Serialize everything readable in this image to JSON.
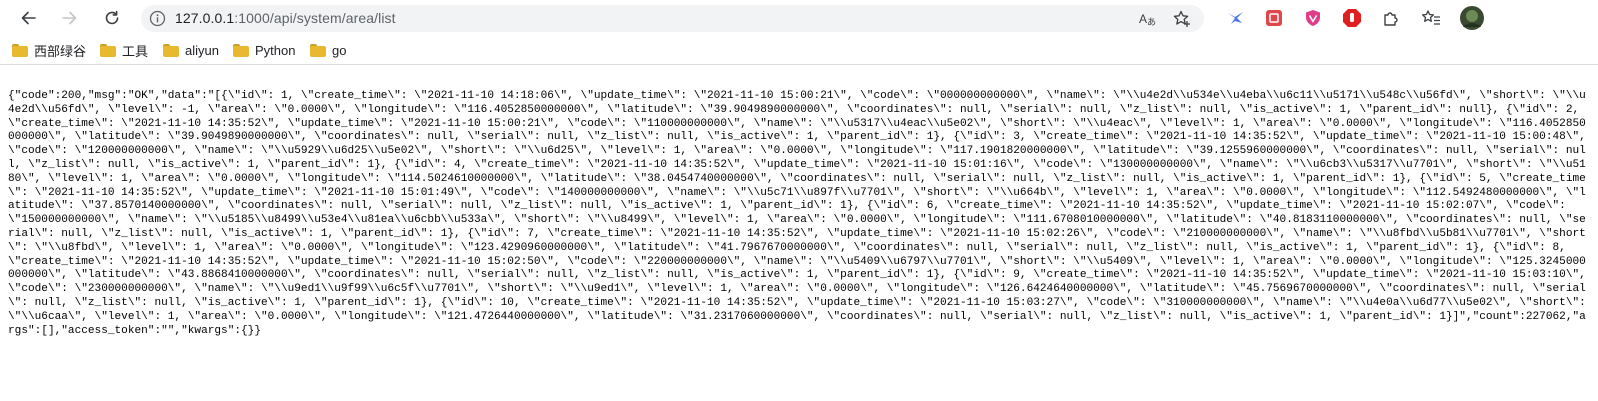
{
  "toolbar": {
    "back_icon": "arrow-left-icon",
    "forward_icon": "arrow-right-icon",
    "reload_icon": "reload-icon",
    "info_icon": "info-icon",
    "url_host": "127.0.0.1",
    "url_path": ":1000/api/system/area/list",
    "read_aloud_icon": "read-aloud-icon",
    "add_favorite_icon": "add-favorite-icon",
    "extensions": [
      "bird-extension-icon",
      "red-square-extension-icon",
      "heart-shield-extension-icon",
      "stop-hand-extension-icon",
      "puzzle-extensions-icon",
      "favorites-icon",
      "profile-avatar"
    ]
  },
  "bookmarks": [
    {
      "label": "西部绿谷",
      "icon": "folder-icon"
    },
    {
      "label": "工具",
      "icon": "folder-icon"
    },
    {
      "label": "aliyun",
      "icon": "folder-icon"
    },
    {
      "label": "Python",
      "icon": "folder-icon"
    },
    {
      "label": "go",
      "icon": "folder-icon"
    }
  ],
  "response_text": "{\"code\":200,\"msg\":\"OK\",\"data\":\"[{\\\"id\\\": 1, \\\"create_time\\\": \\\"2021-11-10 14:18:06\\\", \\\"update_time\\\": \\\"2021-11-10 15:00:21\\\", \\\"code\\\": \\\"000000000000\\\", \\\"name\\\": \\\"\\\\u4e2d\\\\u534e\\\\u4eba\\\\u6c11\\\\u5171\\\\u548c\\\\u56fd\\\", \\\"short\\\": \\\"\\\\u4e2d\\\\u56fd\\\", \\\"level\\\": -1, \\\"area\\\": \\\"0.0000\\\", \\\"longitude\\\": \\\"116.4052850000000\\\", \\\"latitude\\\": \\\"39.9049890000000\\\", \\\"coordinates\\\": null, \\\"serial\\\": null, \\\"z_list\\\": null, \\\"is_active\\\": 1, \\\"parent_id\\\": null}, {\\\"id\\\": 2, \\\"create_time\\\": \\\"2021-11-10 14:35:52\\\", \\\"update_time\\\": \\\"2021-11-10 15:00:21\\\", \\\"code\\\": \\\"110000000000\\\", \\\"name\\\": \\\"\\\\u5317\\\\u4eac\\\\u5e02\\\", \\\"short\\\": \\\"\\\\u4eac\\\", \\\"level\\\": 1, \\\"area\\\": \\\"0.0000\\\", \\\"longitude\\\": \\\"116.4052850000000\\\", \\\"latitude\\\": \\\"39.9049890000000\\\", \\\"coordinates\\\": null, \\\"serial\\\": null, \\\"z_list\\\": null, \\\"is_active\\\": 1, \\\"parent_id\\\": 1}, {\\\"id\\\": 3, \\\"create_time\\\": \\\"2021-11-10 14:35:52\\\", \\\"update_time\\\": \\\"2021-11-10 15:00:48\\\", \\\"code\\\": \\\"120000000000\\\", \\\"name\\\": \\\"\\\\u5929\\\\u6d25\\\\u5e02\\\", \\\"short\\\": \\\"\\\\u6d25\\\", \\\"level\\\": 1, \\\"area\\\": \\\"0.0000\\\", \\\"longitude\\\": \\\"117.1901820000000\\\", \\\"latitude\\\": \\\"39.1255960000000\\\", \\\"coordinates\\\": null, \\\"serial\\\": null, \\\"z_list\\\": null, \\\"is_active\\\": 1, \\\"parent_id\\\": 1}, {\\\"id\\\": 4, \\\"create_time\\\": \\\"2021-11-10 14:35:52\\\", \\\"update_time\\\": \\\"2021-11-10 15:01:16\\\", \\\"code\\\": \\\"130000000000\\\", \\\"name\\\": \\\"\\\\u6cb3\\\\u5317\\\\u7701\\\", \\\"short\\\": \\\"\\\\u5180\\\", \\\"level\\\": 1, \\\"area\\\": \\\"0.0000\\\", \\\"longitude\\\": \\\"114.5024610000000\\\", \\\"latitude\\\": \\\"38.0454740000000\\\", \\\"coordinates\\\": null, \\\"serial\\\": null, \\\"z_list\\\": null, \\\"is_active\\\": 1, \\\"parent_id\\\": 1}, {\\\"id\\\": 5, \\\"create_time\\\": \\\"2021-11-10 14:35:52\\\", \\\"update_time\\\": \\\"2021-11-10 15:01:49\\\", \\\"code\\\": \\\"140000000000\\\", \\\"name\\\": \\\"\\\\u5c71\\\\u897f\\\\u7701\\\", \\\"short\\\": \\\"\\\\u664b\\\", \\\"level\\\": 1, \\\"area\\\": \\\"0.0000\\\", \\\"longitude\\\": \\\"112.5492480000000\\\", \\\"latitude\\\": \\\"37.8570140000000\\\", \\\"coordinates\\\": null, \\\"serial\\\": null, \\\"z_list\\\": null, \\\"is_active\\\": 1, \\\"parent_id\\\": 1}, {\\\"id\\\": 6, \\\"create_time\\\": \\\"2021-11-10 14:35:52\\\", \\\"update_time\\\": \\\"2021-11-10 15:02:07\\\", \\\"code\\\": \\\"150000000000\\\", \\\"name\\\": \\\"\\\\u5185\\\\u8499\\\\u53e4\\\\u81ea\\\\u6cbb\\\\u533a\\\", \\\"short\\\": \\\"\\\\u8499\\\", \\\"level\\\": 1, \\\"area\\\": \\\"0.0000\\\", \\\"longitude\\\": \\\"111.6708010000000\\\", \\\"latitude\\\": \\\"40.8183110000000\\\", \\\"coordinates\\\": null, \\\"serial\\\": null, \\\"z_list\\\": null, \\\"is_active\\\": 1, \\\"parent_id\\\": 1}, {\\\"id\\\": 7, \\\"create_time\\\": \\\"2021-11-10 14:35:52\\\", \\\"update_time\\\": \\\"2021-11-10 15:02:26\\\", \\\"code\\\": \\\"210000000000\\\", \\\"name\\\": \\\"\\\\u8fbd\\\\u5b81\\\\u7701\\\", \\\"short\\\": \\\"\\\\u8fbd\\\", \\\"level\\\": 1, \\\"area\\\": \\\"0.0000\\\", \\\"longitude\\\": \\\"123.4290960000000\\\", \\\"latitude\\\": \\\"41.7967670000000\\\", \\\"coordinates\\\": null, \\\"serial\\\": null, \\\"z_list\\\": null, \\\"is_active\\\": 1, \\\"parent_id\\\": 1}, {\\\"id\\\": 8, \\\"create_time\\\": \\\"2021-11-10 14:35:52\\\", \\\"update_time\\\": \\\"2021-11-10 15:02:50\\\", \\\"code\\\": \\\"220000000000\\\", \\\"name\\\": \\\"\\\\u5409\\\\u6797\\\\u7701\\\", \\\"short\\\": \\\"\\\\u5409\\\", \\\"level\\\": 1, \\\"area\\\": \\\"0.0000\\\", \\\"longitude\\\": \\\"125.3245000000000\\\", \\\"latitude\\\": \\\"43.8868410000000\\\", \\\"coordinates\\\": null, \\\"serial\\\": null, \\\"z_list\\\": null, \\\"is_active\\\": 1, \\\"parent_id\\\": 1}, {\\\"id\\\": 9, \\\"create_time\\\": \\\"2021-11-10 14:35:52\\\", \\\"update_time\\\": \\\"2021-11-10 15:03:10\\\", \\\"code\\\": \\\"230000000000\\\", \\\"name\\\": \\\"\\\\u9ed1\\\\u9f99\\\\u6c5f\\\\u7701\\\", \\\"short\\\": \\\"\\\\u9ed1\\\", \\\"level\\\": 1, \\\"area\\\": \\\"0.0000\\\", \\\"longitude\\\": \\\"126.6424640000000\\\", \\\"latitude\\\": \\\"45.7569670000000\\\", \\\"coordinates\\\": null, \\\"serial\\\": null, \\\"z_list\\\": null, \\\"is_active\\\": 1, \\\"parent_id\\\": 1}, {\\\"id\\\": 10, \\\"create_time\\\": \\\"2021-11-10 14:35:52\\\", \\\"update_time\\\": \\\"2021-11-10 15:03:27\\\", \\\"code\\\": \\\"310000000000\\\", \\\"name\\\": \\\"\\\\u4e0a\\\\u6d77\\\\u5e02\\\", \\\"short\\\": \\\"\\\\u6caa\\\", \\\"level\\\": 1, \\\"area\\\": \\\"0.0000\\\", \\\"longitude\\\": \\\"121.4726440000000\\\", \\\"latitude\\\": \\\"31.2317060000000\\\", \\\"coordinates\\\": null, \\\"serial\\\": null, \\\"z_list\\\": null, \\\"is_active\\\": 1, \\\"parent_id\\\": 1}]\",\"count\":227062,\"args\":[],\"access_token\":\"\",\"kwargs\":{}}"
}
